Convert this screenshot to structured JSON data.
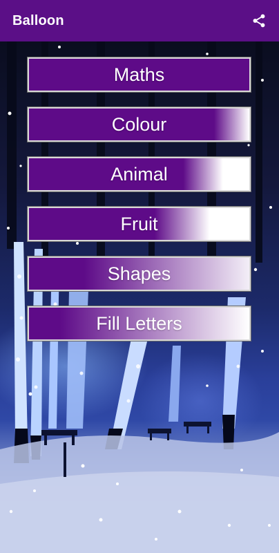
{
  "app_bar": {
    "title": "Balloon",
    "share_icon": "share-icon",
    "color": "#5b0f87"
  },
  "menu": {
    "items": [
      {
        "label": "Maths"
      },
      {
        "label": "Colour"
      },
      {
        "label": "Animal"
      },
      {
        "label": "Fruit"
      },
      {
        "label": "Shapes"
      },
      {
        "label": "Fill Letters"
      }
    ],
    "button_color": "#5e0b88"
  }
}
